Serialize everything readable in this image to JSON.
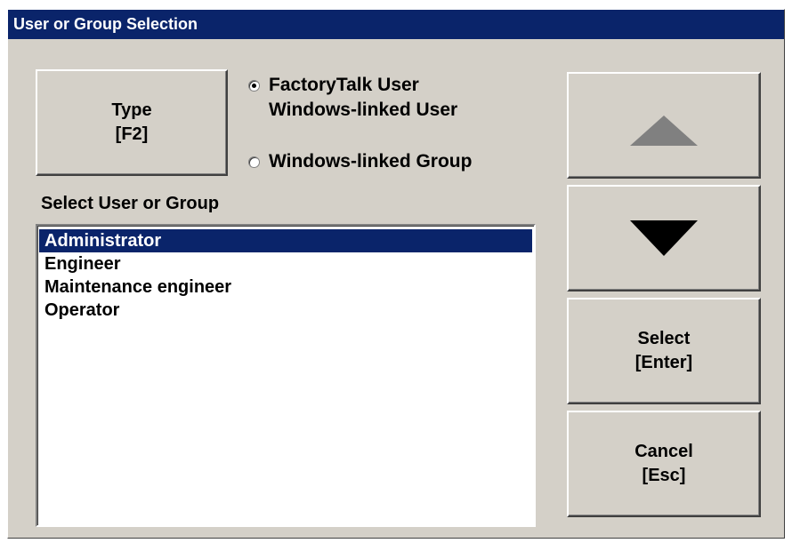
{
  "window": {
    "title": "User or Group Selection"
  },
  "type_button": {
    "label": "Type\n[F2]"
  },
  "radio_options": [
    {
      "label": "FactoryTalk User\nWindows-linked User",
      "checked": true
    },
    {
      "label": "Windows-linked Group",
      "checked": false
    }
  ],
  "list": {
    "label": "Select User or Group",
    "items": [
      "Administrator",
      "Engineer",
      "Maintenance engineer",
      "Operator"
    ],
    "selected_index": 0
  },
  "buttons": {
    "up": {
      "icon": "triangle-up-icon",
      "enabled": false
    },
    "down": {
      "icon": "triangle-down-icon",
      "enabled": true
    },
    "select_label": "Select\n[Enter]",
    "cancel_label": "Cancel\n[Esc]"
  },
  "colors": {
    "title_bar": "#0a246a",
    "face": "#d4d0c8",
    "selection": "#0a246a",
    "disabled_arrow": "#808080"
  }
}
